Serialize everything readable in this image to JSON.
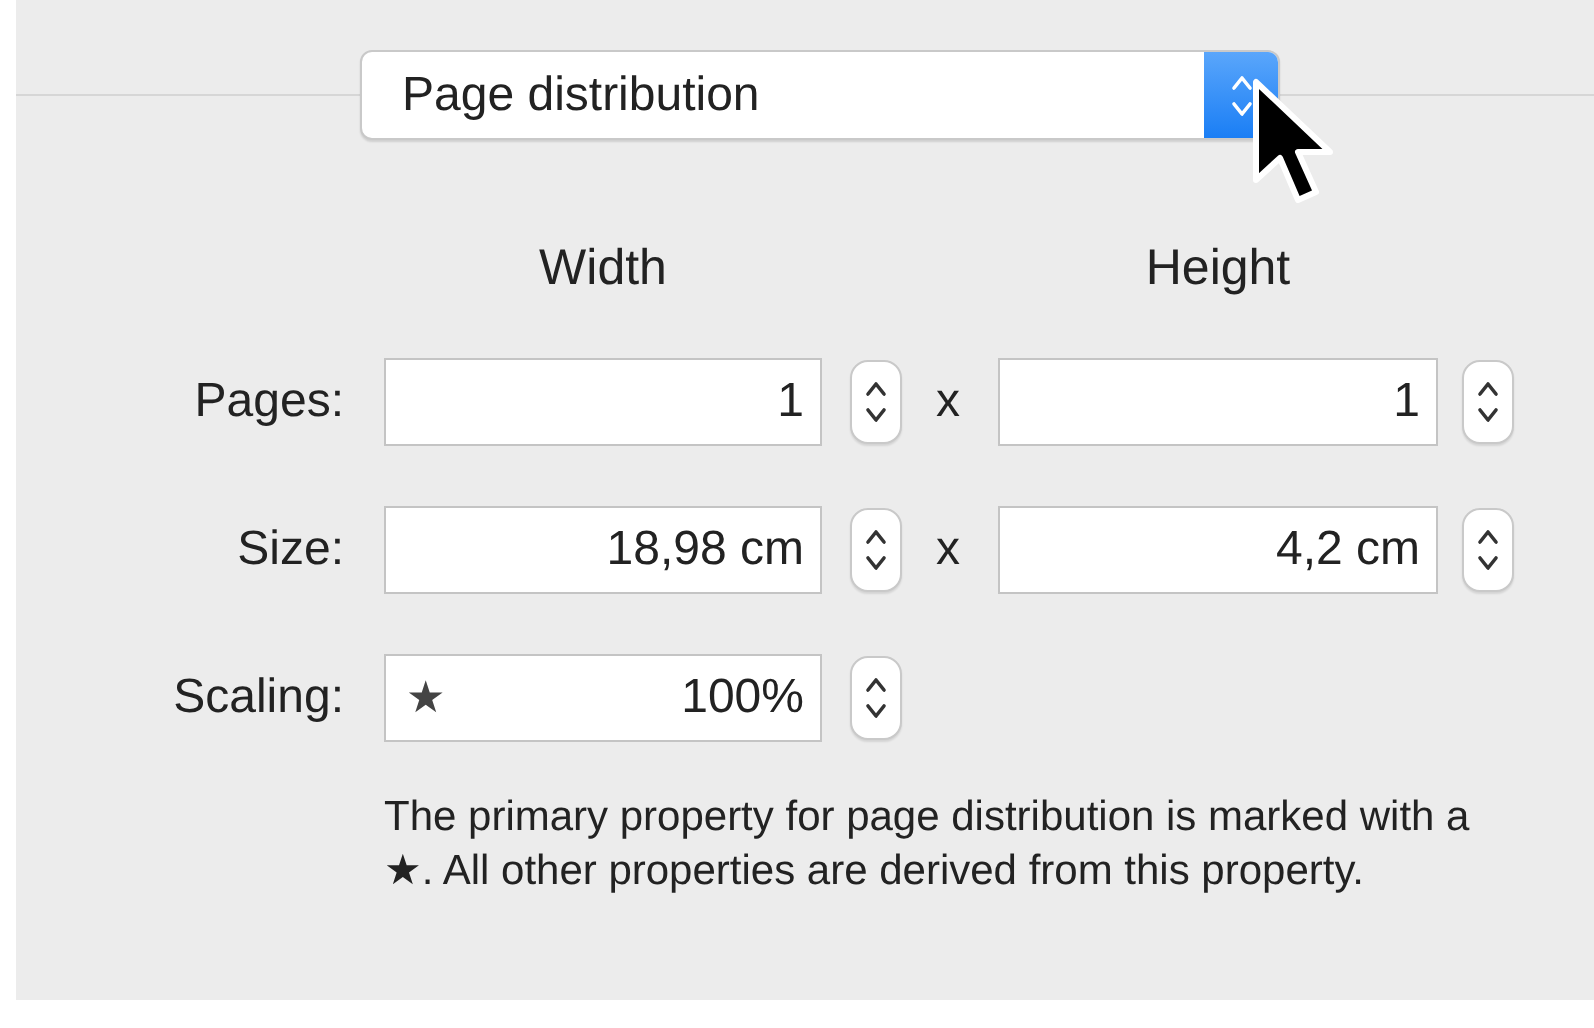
{
  "popup": {
    "value": "Page distribution"
  },
  "columns": [
    "Width",
    "Height"
  ],
  "rows": [
    {
      "label": "Pages:",
      "separator": "x",
      "fields": [
        {
          "value": "1"
        },
        {
          "value": "1"
        }
      ]
    },
    {
      "label": "Size:",
      "separator": "x",
      "fields": [
        {
          "value": "18,98 cm"
        },
        {
          "value": "4,2 cm"
        }
      ]
    },
    {
      "label": "Scaling:",
      "fields": [
        {
          "marker": "★",
          "value": "100%"
        }
      ]
    }
  ],
  "note": "The primary property for page distribution is marked with a ★. All other properties are derived from this property."
}
